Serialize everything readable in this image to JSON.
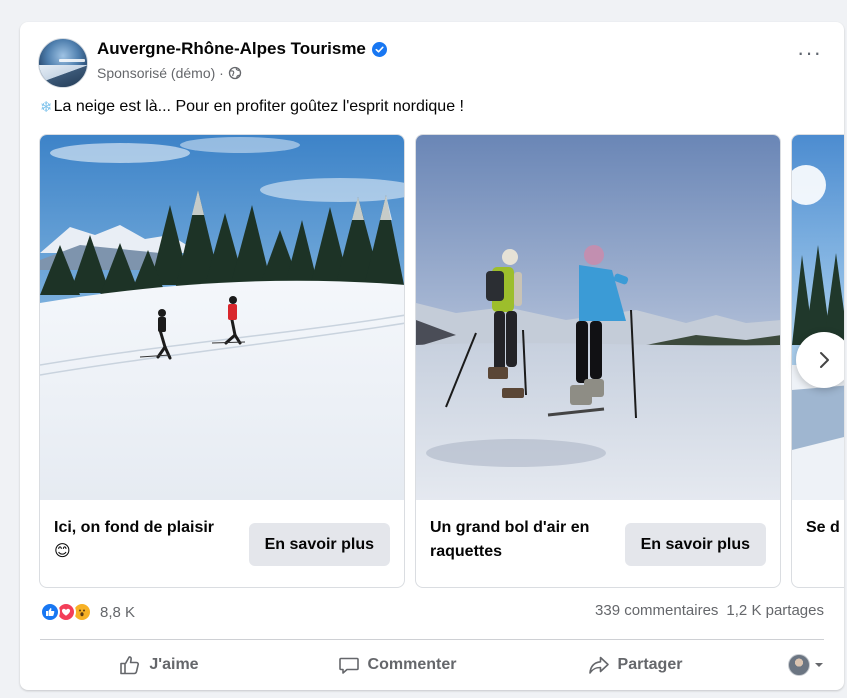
{
  "post": {
    "page_name": "Auvergne-Rhône-Alpes Tourisme",
    "sponsored_label": "Sponsorisé (démo) ·",
    "more_label": "···",
    "caption": "La neige est là... Pour en profiter goûtez l'esprit nordique !",
    "avatar_icon": "brand-logo-icon"
  },
  "carousel": {
    "slides": [
      {
        "title": "Ici, on fond de plaisir 😊",
        "cta": "En savoir plus",
        "image": "cross-country-skiers-photo"
      },
      {
        "title": "Un grand bol d'air en raquettes",
        "cta": "En savoir plus",
        "image": "snowshoe-hikers-photo"
      },
      {
        "title": "Se d rythi",
        "image": "snowy-forest-photo"
      }
    ],
    "next_icon": "chevron-right-icon"
  },
  "engagement": {
    "reaction_icons": [
      "like-icon",
      "love-icon",
      "wow-icon"
    ],
    "reaction_count": "8,8 K",
    "comments": "339 commentaires",
    "shares": "1,2 K partages"
  },
  "actions": {
    "like": "J'aime",
    "comment": "Commenter",
    "share": "Partager"
  },
  "colors": {
    "facebook_blue": "#1877f2",
    "muted_text": "#65676b",
    "button_bg": "#e4e6eb"
  }
}
